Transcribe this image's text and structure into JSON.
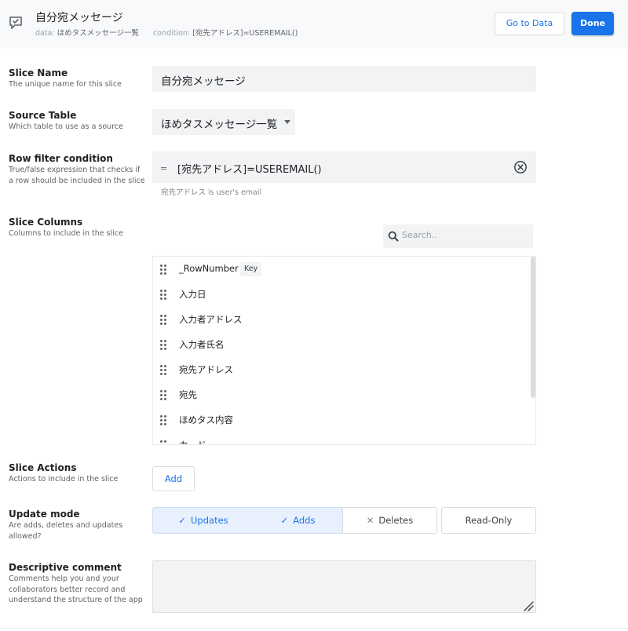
{
  "header": {
    "title": "自分宛メッセージ",
    "data_label": "data:",
    "data_value": "ほめタスメッセージ一覧",
    "condition_label": "condition:",
    "condition_value": "[宛先アドレス]=USEREMAIL()",
    "go_to_data_label": "Go to Data",
    "done_label": "Done"
  },
  "slice_name": {
    "title": "Slice Name",
    "description": "The unique name for this slice",
    "value": "自分宛メッセージ"
  },
  "source_table": {
    "title": "Source Table",
    "description": "Which table to use as a source",
    "value": "ほめタスメッセージ一覧"
  },
  "row_filter": {
    "title": "Row filter condition",
    "description": "True/false expression that checks if a row should be included in the slice",
    "operator": "=",
    "value": "[宛先アドレス]=USEREMAIL()",
    "helper_field": "宛先アドレス",
    "helper_text": " is user's email"
  },
  "slice_columns": {
    "title": "Slice Columns",
    "description": "Columns to include in the slice",
    "search_placeholder": "Search..",
    "key_badge": "Key",
    "columns": [
      "_RowNumber",
      "入力日",
      "入力者アドレス",
      "入力者氏名",
      "宛先アドレス",
      "宛先",
      "ほめタス内容",
      "カード"
    ]
  },
  "slice_actions": {
    "title": "Slice Actions",
    "description": "Actions to include in the slice",
    "add_label": "Add"
  },
  "update_mode": {
    "title": "Update mode",
    "description": "Are adds, deletes and updates allowed?",
    "options": [
      {
        "label": "Updates",
        "mark": "✓",
        "selected": true
      },
      {
        "label": "Adds",
        "mark": "✓",
        "selected": true
      },
      {
        "label": "Deletes",
        "mark": "✕",
        "selected": false
      },
      {
        "label": "Read-Only",
        "mark": "",
        "selected": false
      }
    ]
  },
  "descriptive_comment": {
    "title": "Descriptive comment",
    "description": "Comments help you and your collaborators better record and understand the structure of the app",
    "value": ""
  },
  "colors": {
    "accent": "#1a73e8",
    "selected_bg": "#e8f0fe",
    "field_bg": "#f1f3f4"
  }
}
